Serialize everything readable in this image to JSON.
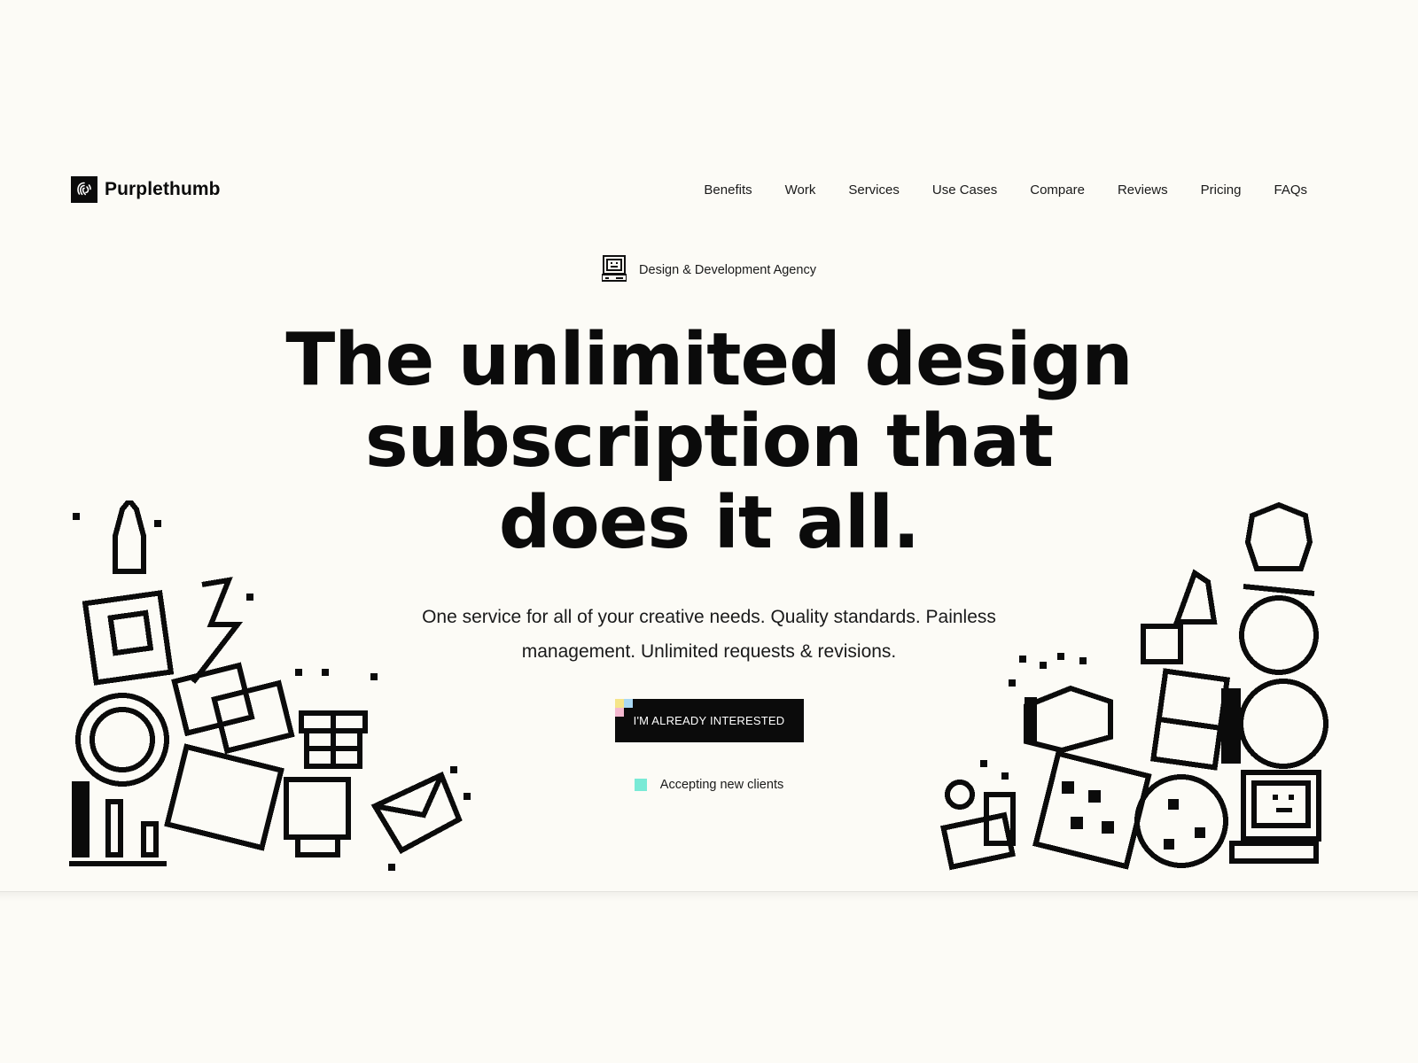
{
  "brand": {
    "name": "Purplethumb",
    "logo_icon": "thumbprint-icon"
  },
  "nav": {
    "items": [
      {
        "label": "Benefits"
      },
      {
        "label": "Work"
      },
      {
        "label": "Services"
      },
      {
        "label": "Use Cases"
      },
      {
        "label": "Compare"
      },
      {
        "label": "Reviews"
      },
      {
        "label": "Pricing"
      },
      {
        "label": "FAQs"
      }
    ]
  },
  "hero": {
    "eyebrow_icon": "retro-computer-icon",
    "eyebrow": "Design & Development Agency",
    "title": "The unlimited design subscription that does it all.",
    "subtitle": "One service for all of your creative needs. Quality standards. Painless management. Unlimited requests & revisions.",
    "cta_label": "I'M ALREADY INTERESTED",
    "status": "Accepting new clients"
  },
  "colors": {
    "background": "#fcfbf6",
    "ink": "#0b0b0b",
    "status_dot": "#79ead6",
    "cta_pixel_yellow": "#f5e58a",
    "cta_pixel_blue": "#a9d8f3",
    "cta_pixel_pink": "#f4b8cf"
  }
}
